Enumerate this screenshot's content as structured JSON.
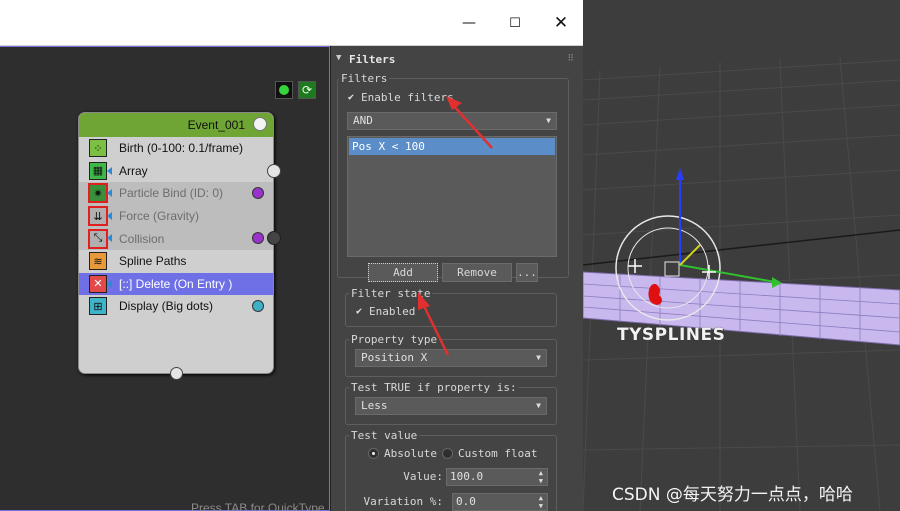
{
  "window": {
    "minimize_glyph": "—",
    "maximize_glyph": "☐",
    "close_glyph": "✕"
  },
  "graph": {
    "status_text": "Press TAB for QuickType",
    "event": {
      "name": "Event_001",
      "operators": [
        {
          "label": "Birth (0-100: 0.1/frame)",
          "icon": "birth-icon",
          "state": "normal"
        },
        {
          "label": "Array",
          "icon": "array-icon",
          "state": "normal"
        },
        {
          "label": "Particle Bind (ID: 0)",
          "icon": "particle-bind-icon",
          "state": "disabled"
        },
        {
          "label": "Force (Gravity)",
          "icon": "force-icon",
          "state": "disabled"
        },
        {
          "label": "Collision",
          "icon": "collision-icon",
          "state": "disabled"
        },
        {
          "label": "Spline Paths",
          "icon": "spline-paths-icon",
          "state": "normal"
        },
        {
          "label": "[::] Delete (On Entry )",
          "icon": "delete-icon",
          "state": "selected"
        },
        {
          "label": "Display (Big dots)",
          "icon": "display-icon",
          "state": "normal"
        }
      ]
    }
  },
  "panel": {
    "rollout_title": "Filters",
    "filters_group": {
      "title": "Filters",
      "enable_filters_label": "Enable filters",
      "enable_filters_checked": true,
      "logic_value": "AND",
      "list_items": [
        "Pos X < 100"
      ],
      "add_label": "Add",
      "remove_label": "Remove",
      "more_label": "..."
    },
    "filter_state": {
      "title": "Filter state",
      "enabled_label": "Enabled",
      "enabled_checked": true
    },
    "property_type": {
      "title": "Property type",
      "value": "Position X"
    },
    "test_true": {
      "title": "Test TRUE if property is:",
      "value": "Less"
    },
    "test_value": {
      "title": "Test value",
      "absolute_label": "Absolute",
      "custom_float_label": "Custom float",
      "selected": "Absolute",
      "value_label": "Value:",
      "value": "100.0",
      "variation_label": "Variation %:",
      "variation": "0.0"
    }
  },
  "viewport": {
    "object_label": "TYSPLINES",
    "axis_labels": {
      "z": "z"
    },
    "colors": {
      "object": "#c8b8ee",
      "z_axis": "#2a3cff",
      "x_axis": "#30c030",
      "y_axis": "#d0d020",
      "pivot": "#e01010"
    }
  },
  "watermark": "CSDN @每天努力一点点，哈哈"
}
